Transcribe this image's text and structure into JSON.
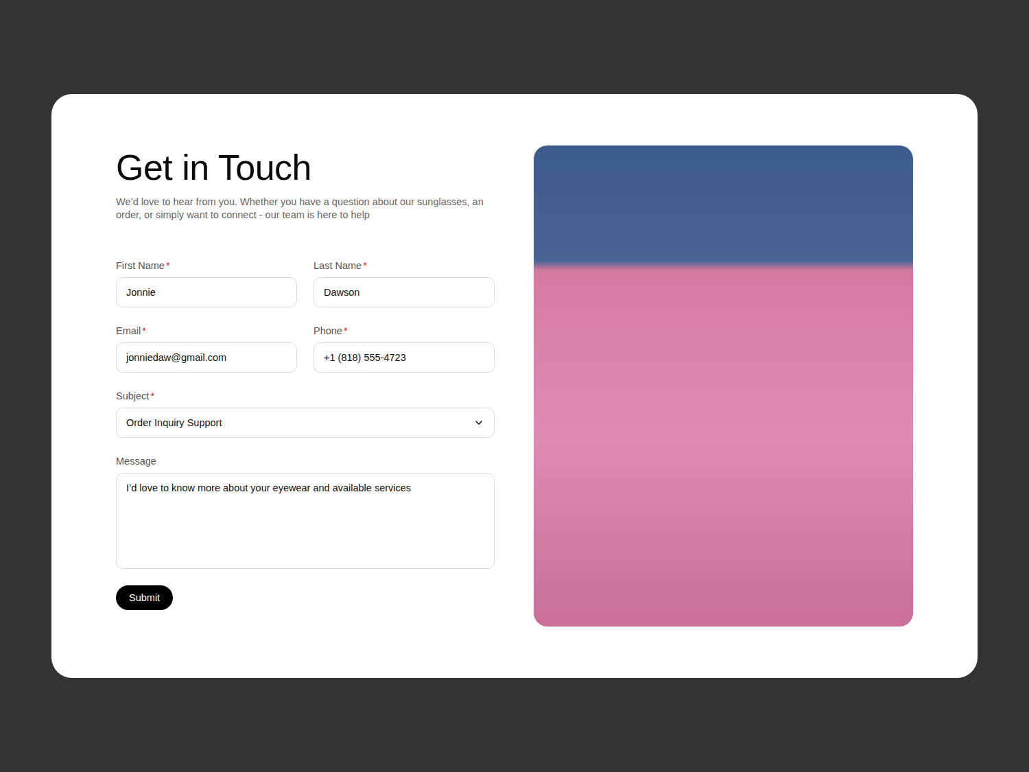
{
  "page": {
    "title": "Get in Touch",
    "subtitle": "We’d love to hear from you. Whether you have a question about our sunglasses, an order, or simply want to connect - our team is here to help"
  },
  "form": {
    "fields": [
      {
        "label": "First Name",
        "required": true,
        "value": "Jonnie",
        "kind": "text"
      },
      {
        "label": "Last Name",
        "required": true,
        "value": "Dawson",
        "kind": "text"
      },
      {
        "label": "Email",
        "required": true,
        "value": "jonniedaw@gmail.com",
        "kind": "text"
      },
      {
        "label": "Phone",
        "required": true,
        "value": "+1 (818) 555-4723",
        "kind": "text"
      },
      {
        "label": "Subject",
        "required": true,
        "value": "Order Inquiry Support",
        "kind": "select"
      },
      {
        "label": "Message",
        "required": false,
        "value": "I’d love to know more about your eyewear and available services",
        "kind": "textarea"
      }
    ],
    "required_mark": "*",
    "submit": "Submit"
  }
}
